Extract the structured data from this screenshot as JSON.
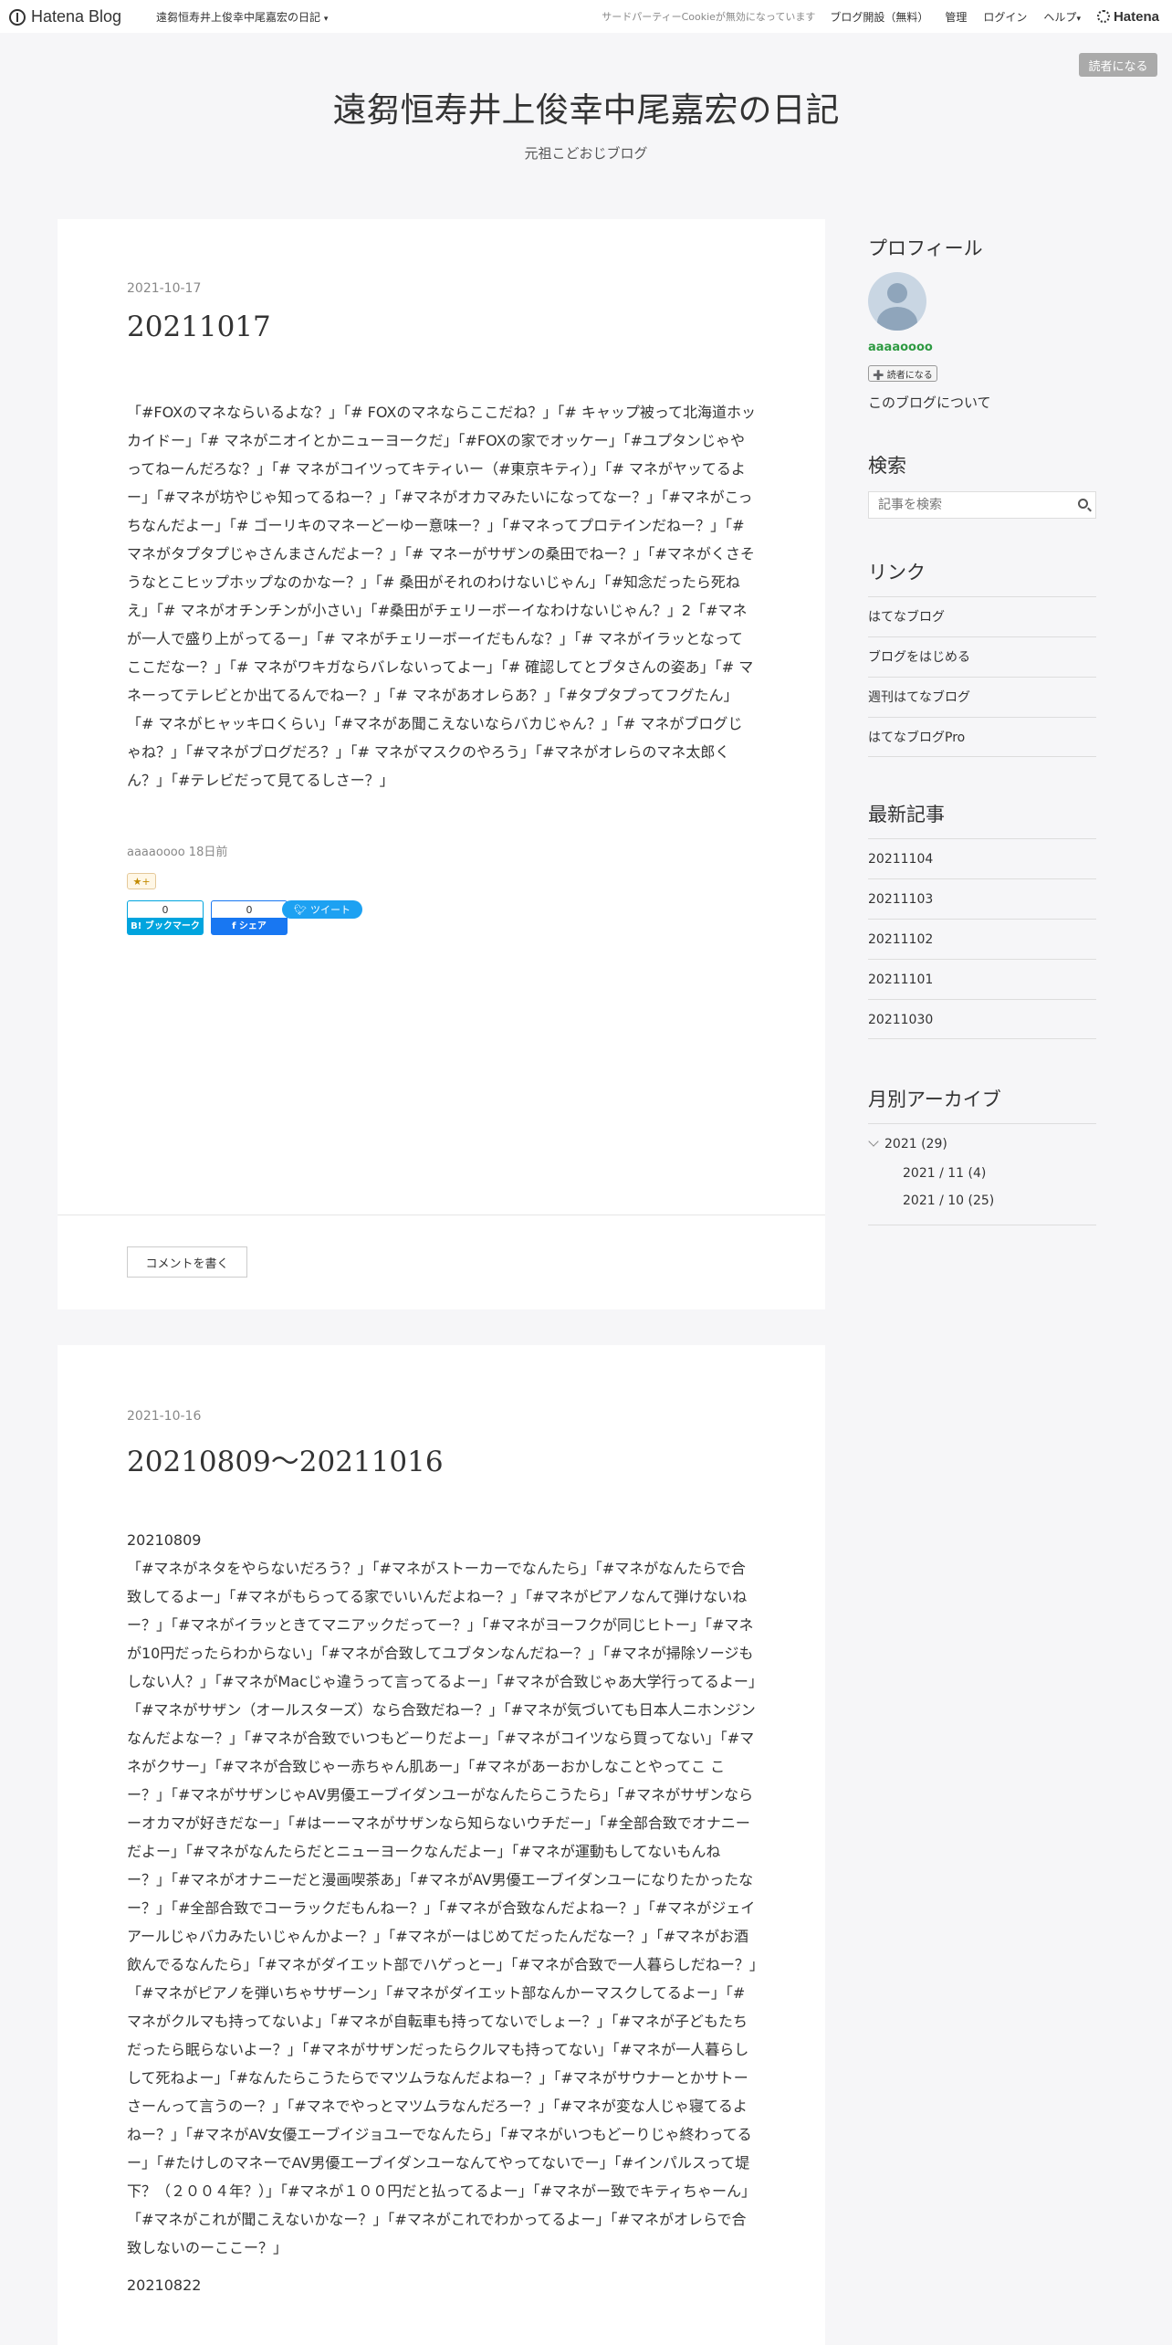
{
  "header": {
    "brand": "Hatena Blog",
    "blog_name": "遠芻恒寿井上俊幸中尾嘉宏の日記",
    "caret": "▾",
    "cookie_notice": "サードパーティーCookieが無効になっています",
    "open_blog": "ブログ開設（無料）",
    "manage": "管理",
    "login": "ログイン",
    "help": "ヘルプ",
    "hatena": "Hatena"
  },
  "reader_button": "読者になる",
  "blog": {
    "title": "遠芻恒寿井上俊幸中尾嘉宏の日記",
    "description": "元祖こどおじブログ"
  },
  "articles": [
    {
      "date": "2021-10-17",
      "title": "20211017",
      "body": "「#FOXのマネならいるよな？」「# FOXのマネならここだね？」「# キャップ被って北海道ホッカイドー」「# マネがニオイとかニューヨークだ」「#FOXの家でオッケー」「#ユプタンじゃやってねーんだろな？」「# マネがコイツってキティいー（#東京キティ）」「# マネがヤッてるよー」「#マネが坊やじゃ知ってるねー？」「#マネがオカマみたいになってなー？」「#マネがこっちなんだよー」「# ゴーリキのマネーどーゆー意味ー？」「#マネってプロテインだねー？」「# マネがタプタプじゃさんまさんだよー？」「# マネーがサザンの桑田でねー？」「#マネがくさそうなとこヒップホップなのかなー？」「# 桑田がそれのわけないじゃん」「#知念だったら死ねえ」「# マネがオチンチンが小さい」「#桑田がチェリーボーイなわけないじゃん？」2「#マネが一人で盛り上がってるー」「# マネがチェリーボーイだもんな？」「# マネがイラッとなってここだなー？」「# マネがワキガならバレないってよー」「# 確認してとブタさんの姿あ」「# マネーってテレビとか出てるんでねー？」「# マネがあオレらあ？」「#タプタプってフグたん」「# マネがヒャッキロくらい」「#マネがあ聞こえないならバカじゃん？」「# マネがブログじゃね？」「#マネがブログだろ？」「# マネがマスクのやろう」「#マネがオレらのマネ太郎くん？」「#テレビだって見てるしさー？」",
      "meta": "aaaaoooo 18日前",
      "star": "★+",
      "bookmark_count": "0",
      "bookmark_label": "B! ブックマーク",
      "share_count": "0",
      "share_label": "f シェア",
      "tweet_label": "ツイート",
      "comment_label": "コメントを書く"
    },
    {
      "date": "2021-10-16",
      "title": "20210809〜20211016",
      "subheading": "20210809",
      "body": "「#マネがネタをやらないだろう？」「#マネがストーカーでなんたら」「#マネがなんたらで合致してるよー」「#マネがもらってる家でいいんだよねー？」「#マネがピアノなんて弾けないねー？」「#マネがイラッときてマニアックだってー？」「#マネがヨーフクが同じヒトー」「#マネが10円だったらわからない」「#マネが合致してユブタンなんだねー？」「#マネが掃除ソージもしない人？」「#マネがMacじゃ違うって言ってるよー」「#マネが合致じゃあ大学行ってるよー」「#マネがサザン（オールスターズ）なら合致だねー？」「#マネが気づいても日本人ニホンジンなんだよなー？」「#マネが合致でいつもどーりだよー」「#マネがコイツなら買ってない」「#マネがクサー」「#マネが合致じゃー赤ちゃん肌あー」「#マネがあーおかしなことやってこ こー？」「#マネがサザンじゃAV男優エーブイダンユーがなんたらこうたら」「#マネがサザンならーオカマが好きだなー」「#はーーマネがサザンなら知らないウチだー」「#全部合致でオナニーだよー」「#マネがなんたらだとニューヨークなんだよー」「#マネが運動もしてないもんねー？」「#マネがオナニーだと漫画喫茶あ」「#マネがAV男優エーブイダンユーになりたかったなー？」「#全部合致でコーラックだもんねー？」「#マネが合致なんだよねー？」「#マネがジェイアールじゃバカみたいじゃんかよー？」「#マネがーはじめてだったんだなー？」「#マネがお酒飲んでるなんたら」「#マネがダイエット部でハゲっとー」「#マネが合致で一人暮らしだねー？」「#マネがピアノを弾いちゃサザーン」「#マネがダイエット部なんかーマスクしてるよー」「#マネがクルマも持ってないよ」「#マネが自転車も持ってないでしょー？」「#マネが子どもたちだったら眠らないよー？」「#マネがサザンだったらクルマも持ってない」「#マネが一人暮らしして死ねよー」「#なんたらこうたらでマツムラなんだよねー？」「#マネがサウナーとかサトーさーんって言うのー？」「#マネでやっとマツムラなんだろー？」「#マネが変な人じゃ寝てるよねー？」「#マネがAV女優エーブイジョユーでなんたら」「#マネがいつもどーりじゃ終わってるー」「#たけしのマネーでAV男優エーブイダンユーなんてやってないでー」「#インパルスって堤下？（２００４年？）」「#マネが１００円だと払ってるよー」「#マネがー致でキティちゃーん」「#マネがこれが聞こえないかなー？」「#マネがこれでわかってるよー」「#マネがオレらで合致しないのーここー？」",
      "next_subheading": "20210822"
    }
  ],
  "sidebar": {
    "profile": {
      "heading": "プロフィール",
      "name": "aaaaoooo",
      "reader_label": "➕ 読者になる",
      "about": "このブログについて"
    },
    "search": {
      "heading": "検索",
      "placeholder": "記事を検索"
    },
    "links": {
      "heading": "リンク",
      "items": [
        "はてなブログ",
        "ブログをはじめる",
        "週刊はてなブログ",
        "はてなブログPro"
      ]
    },
    "recent": {
      "heading": "最新記事",
      "items": [
        "20211104",
        "20211103",
        "20211102",
        "20211101",
        "20211030"
      ]
    },
    "archive": {
      "heading": "月別アーカイブ",
      "year": "2021 (29)",
      "months": [
        "2021 / 11 (4)",
        "2021 / 10 (25)"
      ]
    }
  }
}
